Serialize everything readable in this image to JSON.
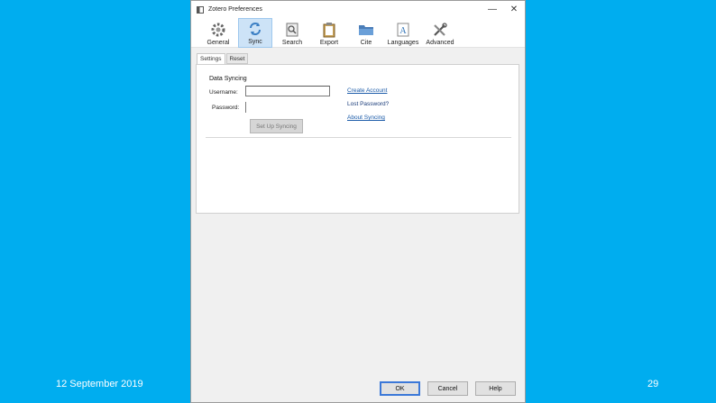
{
  "slide": {
    "date": "12 September 2019",
    "number": "29"
  },
  "window": {
    "title": "Zotero Preferences",
    "minimize": "—",
    "maximize": "☐",
    "close": "✕"
  },
  "toolbar": {
    "items": [
      {
        "label": "General",
        "icon": "gear-icon"
      },
      {
        "label": "Sync",
        "icon": "sync-icon",
        "active": true
      },
      {
        "label": "Search",
        "icon": "search-icon"
      },
      {
        "label": "Export",
        "icon": "clipboard-icon"
      },
      {
        "label": "Cite",
        "icon": "folder-icon"
      },
      {
        "label": "Languages",
        "icon": "language-icon"
      },
      {
        "label": "Advanced",
        "icon": "tools-icon"
      }
    ]
  },
  "tabs": [
    {
      "label": "Settings"
    },
    {
      "label": "Reset"
    }
  ],
  "sync": {
    "group_title": "Data Syncing",
    "username_label": "Username:",
    "username_value": "",
    "password_label": "Password:",
    "password_value": "",
    "setup_button": "Set Up Syncing",
    "links": {
      "create_account": "Create Account",
      "lost_password": "Lost Password?",
      "about_syncing": "About Syncing"
    }
  },
  "buttons": {
    "ok": "OK",
    "cancel": "Cancel",
    "help": "Help"
  },
  "colors": {
    "slide_background": "#00adef",
    "active_tab": "#cde3f7",
    "link": "#1a5aa8"
  }
}
